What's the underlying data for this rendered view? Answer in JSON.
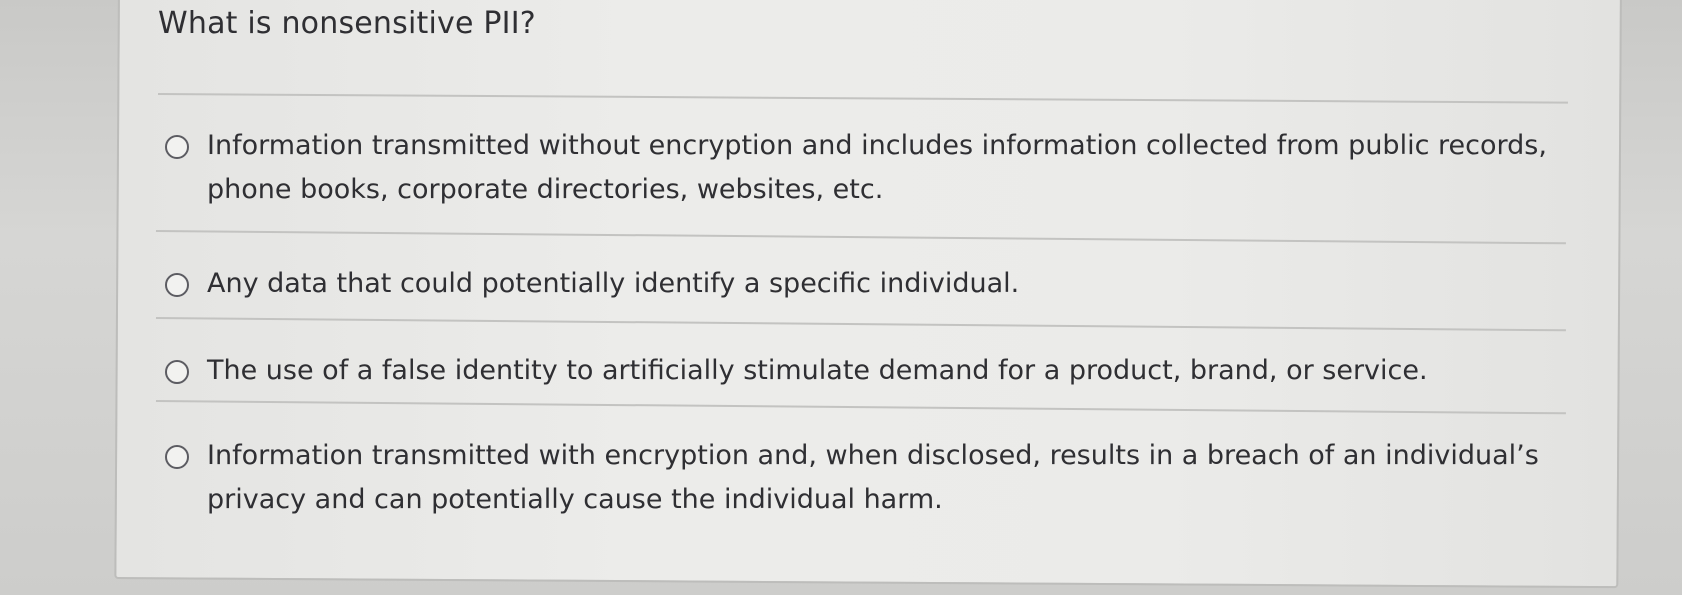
{
  "question": {
    "text": "What is nonsensitive PII?"
  },
  "options": [
    {
      "line1": "Information transmitted without encryption and includes information collected from public records,",
      "line2": "phone books, corporate directories, websites, etc.",
      "selected": false
    },
    {
      "line1": "Any data that could potentially identify a specific individual.",
      "line2": "",
      "selected": false
    },
    {
      "line1": "The use of a false identity to artificially stimulate demand for a product, brand, or service.",
      "line2": "",
      "selected": false
    },
    {
      "line1": "Information transmitted with encryption and, when disclosed, results in a breach of an individual’s",
      "line2": "privacy and can potentially cause the individual harm.",
      "selected": false
    }
  ],
  "colors": {
    "text": "#2f2f33",
    "panel": "#ebebe9",
    "divider": "#c3c3c1",
    "radio_border": "#5c5c62"
  }
}
